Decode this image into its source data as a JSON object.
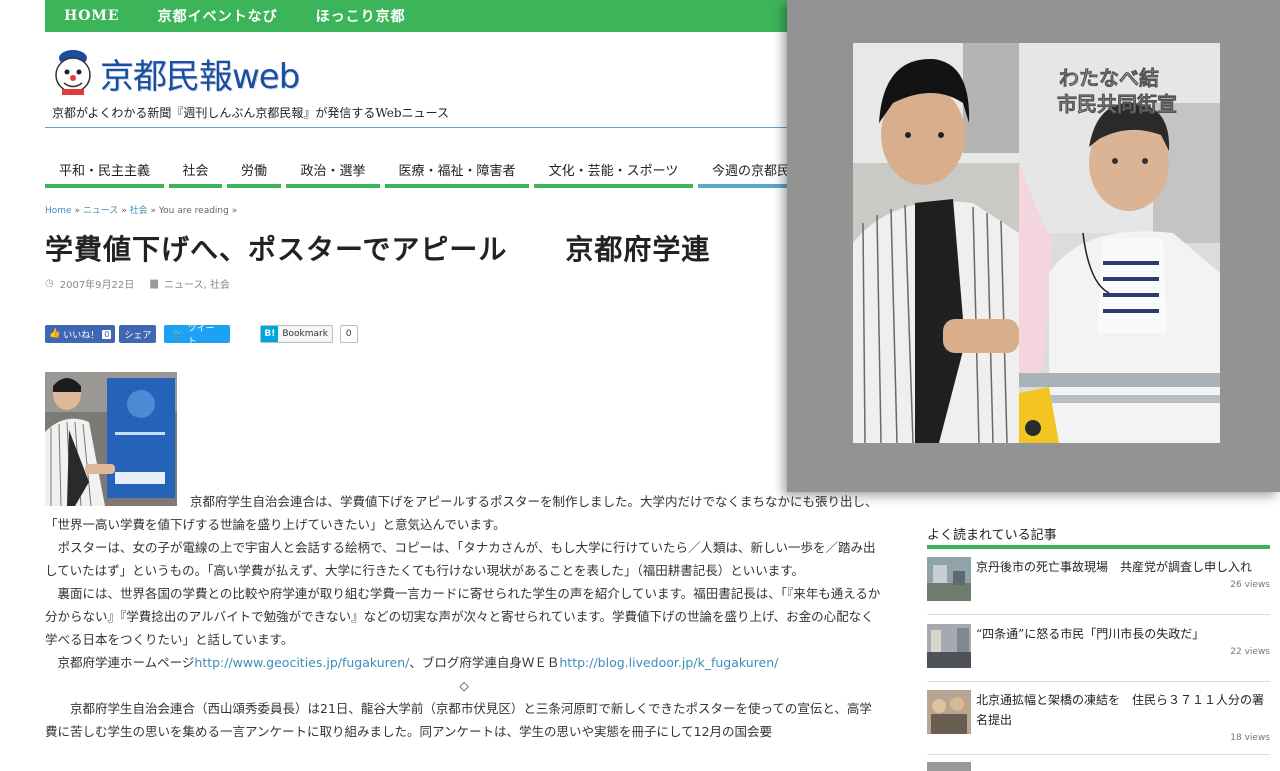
{
  "topnav": [
    "HOME",
    "京都イベントなび",
    "ほっこり京都"
  ],
  "logo": {
    "text": "京都民報web"
  },
  "tagline": "京都がよくわかる新聞『週刊しんぶん京都民報』が発信するWebニュース",
  "categories": [
    "平和・民主主義",
    "社会",
    "労働",
    "政治・選挙",
    "医療・福祉・障害者",
    "文化・芸能・スポーツ",
    "今週の京都民"
  ],
  "breadcrumb": {
    "home": "Home",
    "sep1": " » ",
    "news": "ニュース",
    "sep2": " » ",
    "society": "社会",
    "sep3": " » ",
    "current": "You are reading »"
  },
  "article": {
    "title": "学費値下げへ、ポスターでアピール　　京都府学連",
    "date": "2007年9月22日",
    "categories": "ニュース, 社会",
    "paragraphs": [
      "京都府学生自治会連合は、学費値下げをアピールするポスターを制作しました。大学内だけでなくまちなかにも張り出し、「世界一高い学費を値下げする世論を盛り上げていきたい」と意気込んでいます。",
      "ポスターは、女の子が電線の上で宇宙人と会話する絵柄で、コピーは、「タナカさんが、もし大学に行けていたら／人類は、新しい一歩を／踏み出していたはず」というもの。「高い学費が払えず、大学に行きたくても行けない現状があることを表した」（福田耕書記長）といいます。",
      "裏面には、世界各国の学費との比較や府学連が取り組む学費一言カードに寄せられた学生の声を紹介しています。福田書記長は、「『来年も通えるか分からない』『学費捻出のアルバイトで勉強ができない』などの切実な声が次々と寄せられています。学費値下げの世論を盛り上げ、お金の心配なく学べる日本をつくりたい」と話しています。"
    ],
    "links_prefix": "京都府学連ホームページ",
    "link1": "http://www.geocities.jp/fugakuren/",
    "links_mid": "、ブログ府学連自身ＷＥＢ",
    "link2": "http://blog.livedoor.jp/k_fugakuren/",
    "divider": "◇",
    "paragraph4": "京都府学生自治会連合（西山頌秀委員長）は21日、龍谷大学前（京都市伏見区）と三条河原町で新しくできたポスターを使っての宣伝と、高学費に苦しむ学生の思いを集める一言アンケートに取り組みました。同アンケートは、学生の思いや実態を冊子にして12月の国会要"
  },
  "share": {
    "like": "いいね！",
    "like_count": "0",
    "share": "シェア",
    "tweet": "ツイート",
    "hatena_b": "B!",
    "hatena": "Bookmark",
    "hatena_count": "0"
  },
  "sidebar": {
    "title": "よく読まれている記事",
    "items": [
      {
        "title": "京丹後市の死亡事故現場　共産党が調査し申し入れ",
        "views": "26 views"
      },
      {
        "title": "“四条通”に怒る市民「門川市長の失政だ」",
        "views": "22 views"
      },
      {
        "title": "北京通拡幅と架橋の凍結を　住民ら３７１１人分の署名提出",
        "views": "18 views"
      }
    ]
  },
  "lightbox": {
    "caption": "わたなべ結\n市民共同街宣"
  },
  "colors": {
    "green": "#3cb55a",
    "blue": "#1a4f9f",
    "link": "#3c8dbc",
    "overlay": "#939393"
  }
}
